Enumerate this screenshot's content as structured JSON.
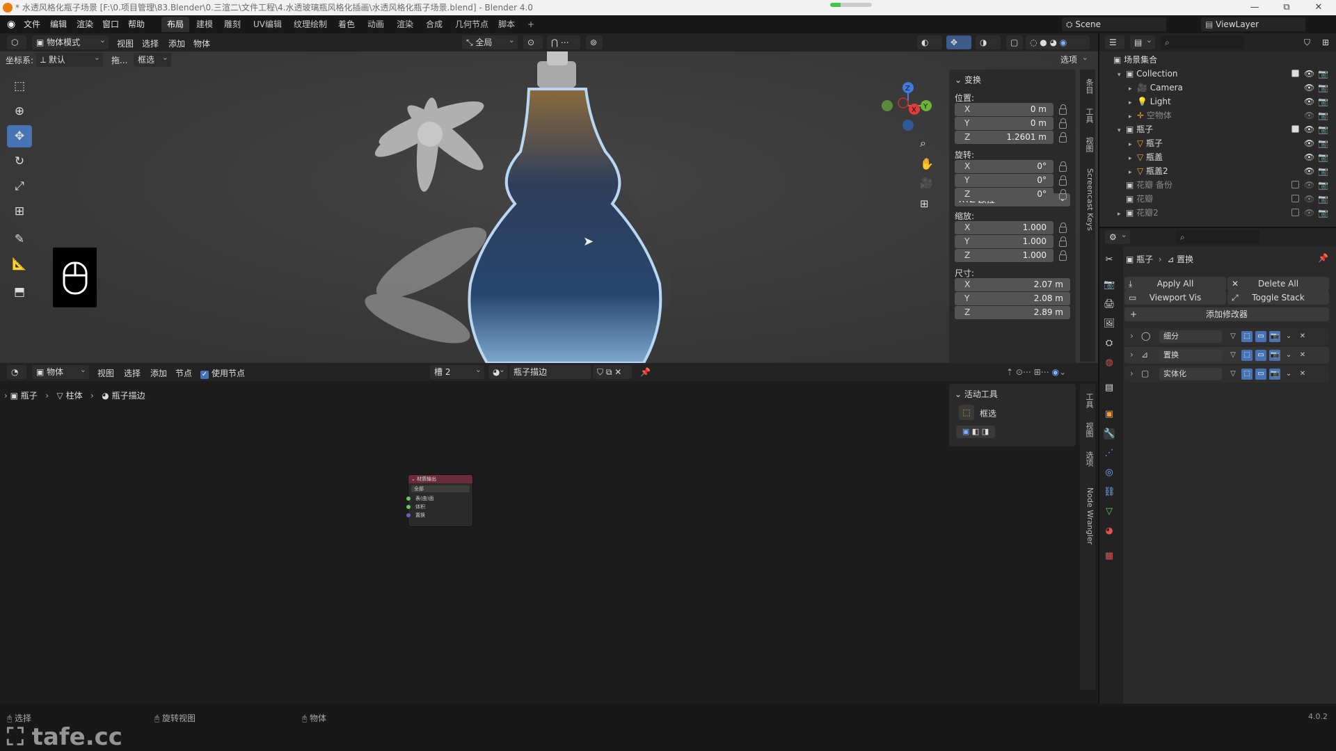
{
  "window": {
    "title": "* 水透风格化瓶子场景 [F:\\0.项目管理\\83.Blender\\0.三渲二\\文件工程\\4.水透玻璃瓶风格化插画\\水透风格化瓶子场景.blend] - Blender 4.0",
    "progress": 0.25,
    "controls": [
      "—",
      "⧉",
      "✕"
    ]
  },
  "menubar": {
    "menus": [
      "文件",
      "编辑",
      "渲染",
      "窗口",
      "帮助"
    ],
    "workspaces": [
      "布局",
      "建模",
      "雕刻",
      "UV编辑",
      "纹理绘制",
      "着色",
      "动画",
      "渲染",
      "合成",
      "几何节点",
      "脚本"
    ],
    "active_workspace": "布局",
    "add_tab": "+",
    "scene": "Scene",
    "view_layer": "ViewLayer"
  },
  "viewport_header": {
    "mode": "物体模式",
    "menus": [
      "视图",
      "选择",
      "添加",
      "物体"
    ],
    "transform_orientation": "全局",
    "options": "选项"
  },
  "viewport_tool_settings": {
    "coord_label": "坐标系:",
    "coord_value": "默认",
    "drag_label": "拖...",
    "drag_value": "框选"
  },
  "tools": [
    "select-box",
    "cursor",
    "move",
    "rotate",
    "scale",
    "transform",
    "annotate",
    "measure",
    "add-cube"
  ],
  "active_tool": "move",
  "n_panel": {
    "title": "变换",
    "location_label": "位置:",
    "location": [
      {
        "k": "X",
        "v": "0 m"
      },
      {
        "k": "Y",
        "v": "0 m"
      },
      {
        "k": "Z",
        "v": "1.2601 m"
      }
    ],
    "rotation_label": "旋转:",
    "rotation": [
      {
        "k": "X",
        "v": "0°"
      },
      {
        "k": "Y",
        "v": "0°"
      },
      {
        "k": "Z",
        "v": "0°"
      }
    ],
    "rotation_mode": "XYZ 欧拉",
    "scale_label": "缩放:",
    "scale": [
      {
        "k": "X",
        "v": "1.000"
      },
      {
        "k": "Y",
        "v": "1.000"
      },
      {
        "k": "Z",
        "v": "1.000"
      }
    ],
    "dimensions_label": "尺寸:",
    "dimensions": [
      {
        "k": "X",
        "v": "2.07 m"
      },
      {
        "k": "Y",
        "v": "2.08 m"
      },
      {
        "k": "Z",
        "v": "2.89 m"
      }
    ]
  },
  "viewport_side_tabs": [
    "条目",
    "工具",
    "视图",
    "Screencast Keys"
  ],
  "outliner": {
    "root": "场景集合",
    "rows": [
      {
        "name": "Collection",
        "icon": "collection-icon"
      },
      {
        "name": "Camera",
        "icon": "camera-icon"
      },
      {
        "name": "Light",
        "icon": "light-icon"
      },
      {
        "name": "空物体",
        "icon": "empty-icon"
      },
      {
        "name": "瓶子",
        "icon": "collection-icon"
      },
      {
        "name": "瓶子",
        "icon": "mesh-icon"
      },
      {
        "name": "瓶盖",
        "icon": "mesh-icon"
      },
      {
        "name": "瓶盖2",
        "icon": "mesh-icon"
      },
      {
        "name": "花瓣 备份",
        "icon": "collection-icon"
      },
      {
        "name": "花瓣",
        "icon": "collection-icon"
      },
      {
        "name": "花瓣2",
        "icon": "collection-icon"
      }
    ]
  },
  "properties": {
    "breadcrumb_object": "瓶子",
    "breadcrumb_modifier": "置换",
    "apply_all": "Apply All",
    "delete_all": "Delete All",
    "viewport_vis": "Viewport Vis",
    "toggle_stack": "Toggle Stack",
    "add_modifier": "添加修改器",
    "modifiers": [
      "细分",
      "置换",
      "实体化"
    ]
  },
  "node_editor": {
    "type": "物体",
    "menus": [
      "视图",
      "选择",
      "添加",
      "节点"
    ],
    "use_nodes": "使用节点",
    "slot": "槽 2",
    "material": "瓶子描边",
    "breadcrumb": [
      "瓶子",
      "柱体",
      "瓶子描边"
    ],
    "node_title": "材质输出",
    "node_target": "全部",
    "node_sockets": [
      "表(曲)面",
      "体积",
      "置换"
    ],
    "active_tool_title": "活动工具",
    "active_tool_name": "框选",
    "side_tabs": [
      "工具",
      "视图",
      "选项",
      "Node Wrangler"
    ]
  },
  "statusbar": {
    "items": [
      "选择",
      "旋转视图",
      "物体"
    ],
    "version": "4.0.2",
    "watermark": "tafe.cc"
  },
  "colors": {
    "accent": "#4772b3",
    "x_axis": "#e23c3c",
    "y_axis": "#6bb33a",
    "z_axis": "#3d7de0"
  }
}
